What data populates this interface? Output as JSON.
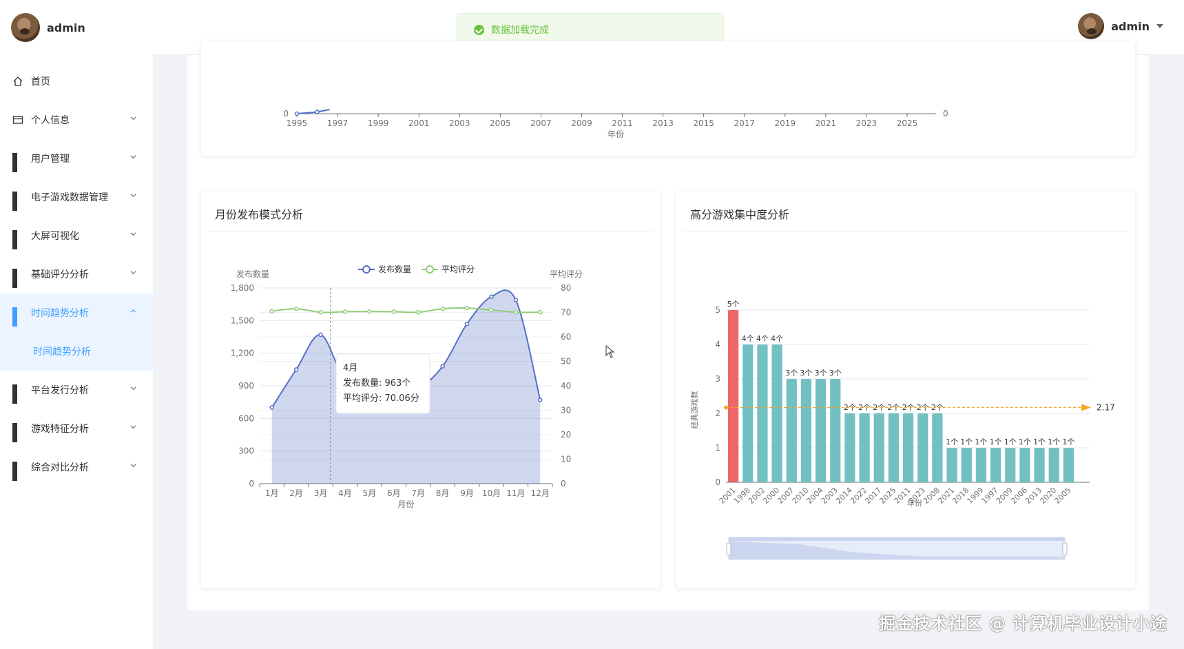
{
  "app": {
    "username": "admin"
  },
  "toast": {
    "message": "数据加载完成"
  },
  "sidebar": {
    "items": [
      {
        "label": "首页",
        "icon": "home-icon",
        "expandable": false
      },
      {
        "label": "个人信息",
        "icon": "card-icon",
        "expandable": true
      },
      {
        "label": "用户管理",
        "icon": "grid-icon",
        "expandable": true
      },
      {
        "label": "电子游戏数据管理",
        "icon": "grid-icon",
        "expandable": true
      },
      {
        "label": "大屏可视化",
        "icon": "grid-icon",
        "expandable": true
      },
      {
        "label": "基础评分分析",
        "icon": "grid-icon",
        "expandable": true
      },
      {
        "label": "时间趋势分析",
        "icon": "grid-icon",
        "expandable": true,
        "active": true,
        "expanded": true
      },
      {
        "label": "平台发行分析",
        "icon": "grid-icon",
        "expandable": true
      },
      {
        "label": "游戏特征分析",
        "icon": "grid-icon",
        "expandable": true
      },
      {
        "label": "综合对比分析",
        "icon": "grid-icon",
        "expandable": true
      }
    ],
    "active_sub": "时间趋势分析"
  },
  "watermark": "掘金技术社区 @ 计算机毕业设计小途",
  "colors": {
    "accent": "#409eff",
    "success": "#67c23a",
    "blue_series": "#5470c6",
    "green_series": "#91cc75",
    "teal_bar": "#73c0c2",
    "red_bar": "#ee6666",
    "orange": "#f5a623"
  },
  "top_chart": {
    "chart_data": {
      "type": "line",
      "x_ticks": [
        "1995",
        "1997",
        "1999",
        "2001",
        "2003",
        "2005",
        "2007",
        "2009",
        "2011",
        "2013",
        "2015",
        "2017",
        "2019",
        "2021",
        "2023",
        "2025"
      ],
      "xlabel": "年份",
      "y_left_visible_tick": "0",
      "y_right_visible_tick": "0",
      "partial_series": [
        {
          "x": 1995,
          "y": 0
        },
        {
          "x": 1996,
          "y": 5
        }
      ],
      "datazoom": true
    }
  },
  "monthly_card": {
    "title": "月份发布模式分析",
    "chart_data": {
      "type": "line",
      "categories": [
        "1月",
        "2月",
        "3月",
        "4月",
        "5月",
        "6月",
        "7月",
        "8月",
        "9月",
        "10月",
        "11月",
        "12月"
      ],
      "series": [
        {
          "name": "发布数量",
          "axis": "left",
          "area": true,
          "values": [
            700,
            1050,
            1370,
            963,
            1000,
            980,
            890,
            1080,
            1470,
            1720,
            1690,
            770
          ]
        },
        {
          "name": "平均评分",
          "axis": "right",
          "values": [
            70.5,
            71.5,
            70.06,
            70.3,
            70.4,
            70.3,
            70.1,
            71.5,
            71.8,
            71,
            70.1,
            70.1
          ]
        }
      ],
      "ylabel_left": "发布数量",
      "ylabel_right": "平均评分",
      "xlabel": "月份",
      "ylim_left": [
        0,
        1800
      ],
      "ylim_right": [
        0,
        80
      ],
      "yticks_left": [
        "0",
        "300",
        "600",
        "900",
        "1,200",
        "1,500",
        "1,800"
      ],
      "yticks_right": [
        "0",
        "10",
        "20",
        "30",
        "40",
        "50",
        "60",
        "70",
        "80"
      ],
      "legend_position": "top-center",
      "tooltip": {
        "title": "4月",
        "line1_label": "发布数量",
        "line1_value": "963个",
        "line2_label": "平均评分",
        "line2_value": "70.06分"
      }
    }
  },
  "highscore_card": {
    "title": "高分游戏集中度分析",
    "chart_data": {
      "type": "bar",
      "categories": [
        "2001",
        "1998",
        "2002",
        "2000",
        "2007",
        "2010",
        "2004",
        "2003",
        "2014",
        "2022",
        "2017",
        "2025",
        "2011",
        "2023",
        "2008",
        "2021",
        "2018",
        "1999",
        "1997",
        "2009",
        "2006",
        "2013",
        "2020",
        "2005"
      ],
      "values": [
        5,
        4,
        4,
        4,
        3,
        3,
        3,
        3,
        2,
        2,
        2,
        2,
        2,
        2,
        2,
        1,
        1,
        1,
        1,
        1,
        1,
        1,
        1,
        1
      ],
      "value_suffix": "个",
      "ylabel": "经典游戏数",
      "xlabel": "年份",
      "ylim": [
        0,
        5
      ],
      "yticks": [
        "0",
        "1",
        "2",
        "3",
        "4",
        "5"
      ],
      "mark_line": {
        "value": 2.17,
        "label": "2.17"
      },
      "highlight_index": 0,
      "datazoom": true
    }
  }
}
